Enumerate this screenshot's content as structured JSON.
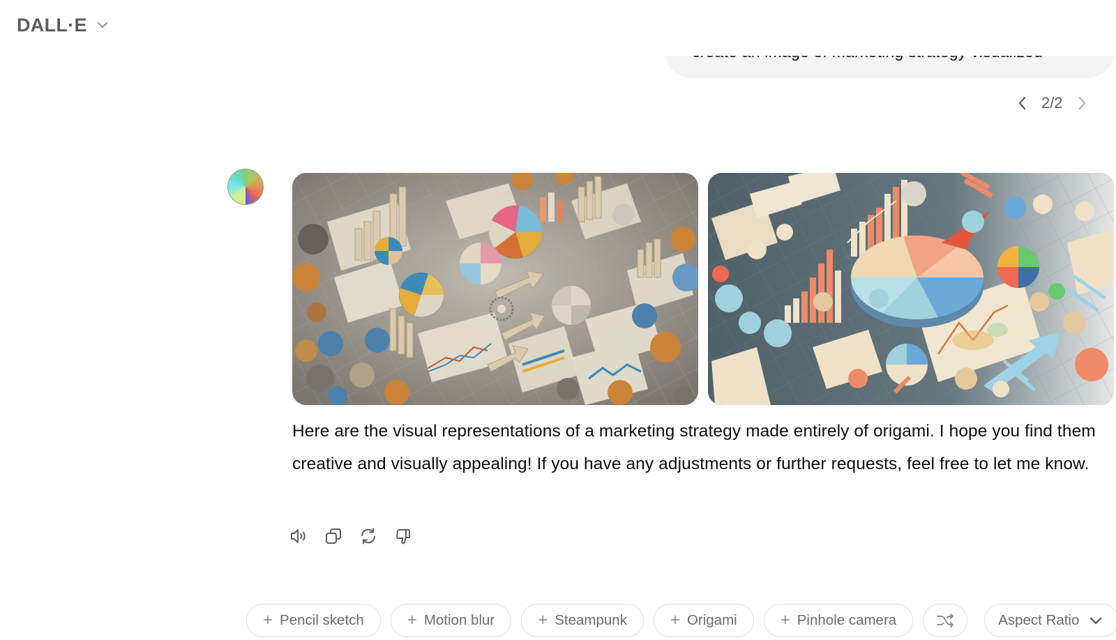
{
  "header": {
    "model_name": "DALL·E",
    "model_dropdown_icon": "chevron-down-icon"
  },
  "conversation": {
    "user_message": "create an image of marketing strategy visualized",
    "pager": {
      "current": 2,
      "total": 2,
      "label": "2/2",
      "prev_icon": "chevron-left-icon",
      "next_icon": "chevron-right-icon"
    },
    "assistant": {
      "avatar_icon": "dalle-avatar",
      "images": [
        {
          "alt": "Origami marketing strategy visualization with pie charts, bar charts, arrows and paper rosettes on a beige grid",
          "palette": [
            "#a49f97",
            "#e9dfcb",
            "#3f8fc0",
            "#f0b43c",
            "#e0743a",
            "#c69a62"
          ]
        },
        {
          "alt": "Origami marketing strategy visualization with a large pastel pie chart, orange bar charts and blue arrows on a slate grid",
          "palette": [
            "#5b6b72",
            "#efe2c8",
            "#9fd2dc",
            "#ef8a68",
            "#6aa8d8",
            "#e5c89e"
          ]
        }
      ],
      "message": "Here are the visual representations of a marketing strategy made entirely of origami. I hope you find them creative and visually appealing! If you have any adjustments or further requests, feel free to let me know.",
      "actions": [
        {
          "name": "read-aloud",
          "icon": "speaker-icon"
        },
        {
          "name": "copy",
          "icon": "copy-icon"
        },
        {
          "name": "regenerate",
          "icon": "refresh-icon"
        },
        {
          "name": "bad-response",
          "icon": "thumbs-down-icon"
        }
      ]
    }
  },
  "style_chips": [
    {
      "label": "Pencil sketch",
      "icon": "plus-icon"
    },
    {
      "label": "Motion blur",
      "icon": "plus-icon"
    },
    {
      "label": "Steampunk",
      "icon": "plus-icon"
    },
    {
      "label": "Origami",
      "icon": "plus-icon"
    },
    {
      "label": "Pinhole camera",
      "icon": "plus-icon"
    }
  ],
  "shuffle": {
    "icon": "shuffle-icon"
  },
  "aspect_ratio": {
    "label": "Aspect Ratio",
    "icon": "chevron-down-icon"
  },
  "plus_glyph": "+"
}
